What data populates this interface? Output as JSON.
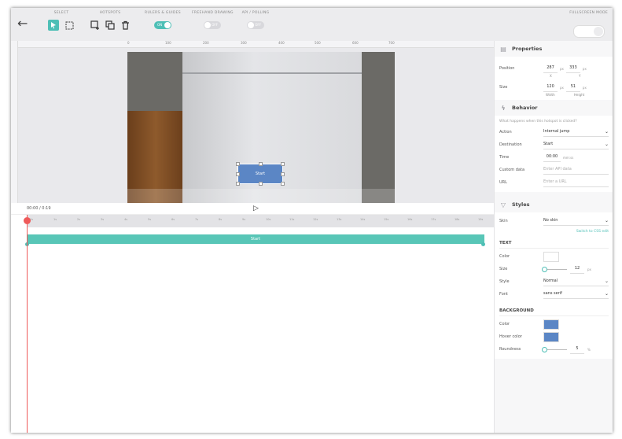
{
  "toolbar": {
    "groups": {
      "select": "SELECT",
      "hotspots": "HOTSPOTS",
      "rulers": "RULERS & GUIDES",
      "freehand": "FREEHAND DRAWING",
      "api": "API / POLLING",
      "fullscreen": "FULLSCREEN MODE"
    },
    "rulers_toggle": "ON",
    "freehand_toggle": "OFF",
    "api_toggle": "OFF"
  },
  "ruler_labels": [
    "0",
    "100",
    "200",
    "300",
    "400",
    "500",
    "600",
    "700"
  ],
  "hotspot": {
    "label": "Start",
    "color": "#5b86c5"
  },
  "timeline": {
    "time": "00:00 / 0:19",
    "track_label": "Start",
    "tick_labels": [
      "0s",
      "1s",
      "2s",
      "3s",
      "4s",
      "5s",
      "6s",
      "7s",
      "8s",
      "9s",
      "10s",
      "11s",
      "12s",
      "13s",
      "14s",
      "15s",
      "16s",
      "17s",
      "18s",
      "19s"
    ]
  },
  "panel": {
    "properties": {
      "title": "Properties",
      "position_label": "Position",
      "pos_x": "287",
      "pos_y": "333",
      "x_label": "X",
      "y_label": "Y",
      "size_label": "Size",
      "width": "120",
      "height": "51",
      "width_label": "Width",
      "height_label": "Height",
      "unit": "px"
    },
    "behavior": {
      "title": "Behavior",
      "hint": "What happens when this hotspot is clicked?",
      "action_label": "Action",
      "action_value": "Internal jump",
      "destination_label": "Destination",
      "destination_value": "Start",
      "time_label": "Time",
      "time_value": "00:00",
      "time_unit": "mm:ss",
      "custom_label": "Custom data",
      "custom_placeholder": "Enter API data",
      "url_label": "URL",
      "url_placeholder": "Enter a URL"
    },
    "styles": {
      "title": "Styles",
      "skin_label": "Skin",
      "skin_value": "No skin",
      "css_link": "Switch to CSS edit",
      "text_heading": "TEXT",
      "color_label": "Color",
      "text_color": "#ffffff",
      "size_label": "Size",
      "size_value": "12",
      "size_unit": "px",
      "style_label": "Style",
      "style_value": "Normal",
      "font_label": "Font",
      "font_value": "sans serif",
      "bg_heading": "BACKGROUND",
      "bg_color_label": "Color",
      "bg_color": "#5b86c5",
      "hover_label": "Hover color",
      "hover_color": "#5b86c5",
      "round_label": "Roundness",
      "round_value": "5",
      "round_unit": "%"
    }
  },
  "colors": {
    "accent": "#4ebfb6",
    "playhead": "#ef5a5a",
    "track": "#58c6b7"
  }
}
